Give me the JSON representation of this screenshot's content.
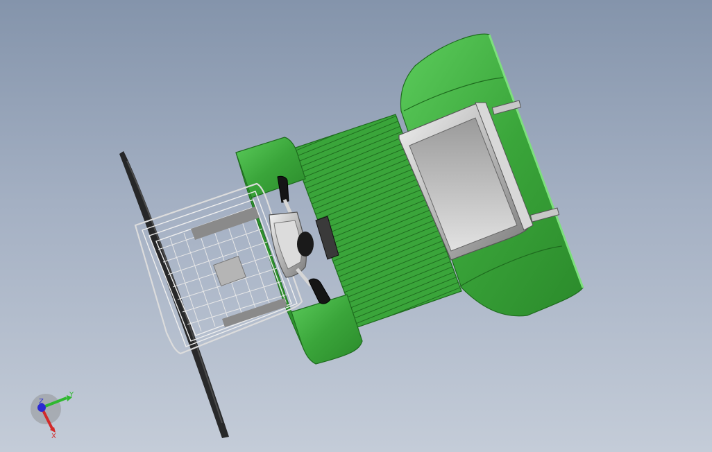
{
  "viewport": {
    "background_top": "#8494ab",
    "background_bottom": "#c4ccd8"
  },
  "model": {
    "body_color": "#3aa53a",
    "body_dark": "#2b8a2b",
    "body_light": "#55c255",
    "metal_color": "#c8c8c8",
    "metal_dark": "#8a8a8a",
    "handle_color": "#1a1a1a",
    "basket_wire": "#e8e8e8"
  },
  "triad": {
    "x_label": "X",
    "y_label": "Y",
    "z_label": "Z",
    "x_color": "#d22a2a",
    "y_color": "#2fb82f",
    "z_color": "#2a2ad2"
  }
}
